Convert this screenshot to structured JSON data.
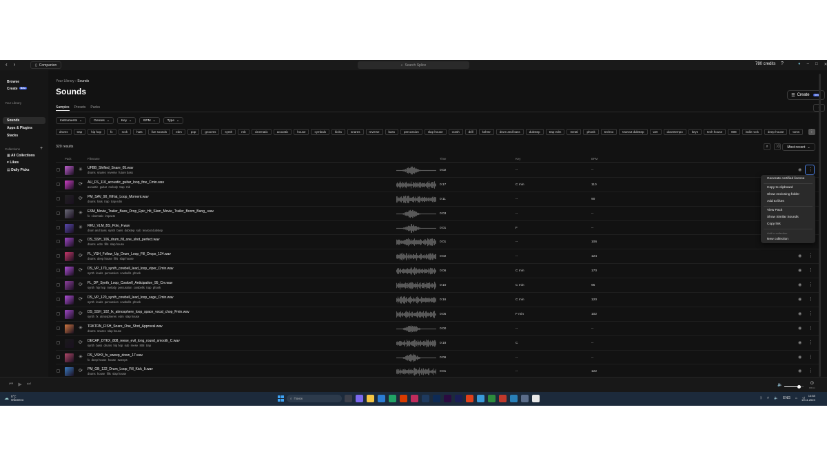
{
  "titlebar": {
    "companion_label": "Companion",
    "search_placeholder": "Search Splice",
    "credits": "780 credits"
  },
  "sidebar": {
    "browse": "Browse",
    "create": "Create",
    "create_badge": "Beta",
    "library_label": "Your Library",
    "sounds": "Sounds",
    "apps_plugins": "Apps & Plugins",
    "stacks": "Stacks",
    "collections_label": "Collections",
    "all_collections": "All Collections",
    "likes": "Likes",
    "daily_picks": "Daily Picks"
  },
  "main": {
    "breadcrumb_parent": "Your Library",
    "breadcrumb_sep": "›",
    "breadcrumb_current": "Sounds",
    "title": "Sounds",
    "create_button": "Create",
    "create_badge": "Beta",
    "tabs": [
      "Samples",
      "Presets",
      "Packs"
    ],
    "filters": [
      "Instruments",
      "Genres",
      "Key",
      "BPM",
      "Type"
    ],
    "chips": [
      "drums",
      "trap",
      "hip hop",
      "fx",
      "rock",
      "hats",
      "live sounds",
      "edm",
      "pop",
      "grooves",
      "synth",
      "rnb",
      "cinematic",
      "acoustic",
      "house",
      "cymbals",
      "kicks",
      "snares",
      "reverse",
      "bass",
      "percussion",
      "slap house",
      "crash",
      "drill",
      "kshmr",
      "drum and bass",
      "dubstep",
      "trap edm",
      "metal",
      "phonk",
      "techno",
      "tearout dubstep",
      "wet",
      "downtempo",
      "keys",
      "tech house",
      "808",
      "indie rock",
      "deep house",
      "toms"
    ],
    "results": "320 results",
    "sort": "Most recent",
    "columns": {
      "pack": "Pack",
      "filename": "Filename",
      "time": "Time",
      "key": "Key",
      "bpm": "BPM"
    }
  },
  "rows": [
    {
      "name": "UFBB_Shifted_Snare_05.wav",
      "tags": [
        "drums",
        "snares",
        "reverse",
        "future bass"
      ],
      "time": "0:02",
      "key": "--",
      "bpm": "--",
      "color": "#c060d0",
      "type": "one-shot"
    },
    {
      "name": "AU_FS_110_acoustic_guitar_loop_fine_Cmin.wav",
      "tags": [
        "acoustic",
        "guitar",
        "melody",
        "trap",
        "rnb"
      ],
      "time": "0:17",
      "key": "C min",
      "bpm": "110",
      "color": "#d040c8",
      "type": "loop"
    },
    {
      "name": "PM_SAV_90_HiHat_Loop_Moment.wav",
      "tags": [
        "drums",
        "hats",
        "trap",
        "trap edm"
      ],
      "time": "0:11",
      "key": "--",
      "bpm": "90",
      "color": "#222222",
      "type": "loop"
    },
    {
      "name": "ESM_Movie_Trailer_Bass_Drop_Epic_Hit_Slam_Movie_Trailer_Boom_Bang_.wav",
      "tags": [
        "fx",
        "cinematic",
        "impacts"
      ],
      "time": "0:03",
      "key": "--",
      "bpm": "--",
      "color": "#6a6a78",
      "type": "one-shot"
    },
    {
      "name": "RKU_VLM_BS_Polo_F.wav",
      "tags": [
        "drum and bass",
        "synth",
        "bass",
        "dubstep",
        "sub",
        "tearout dubstep"
      ],
      "time": "0:01",
      "key": "F",
      "bpm": "--",
      "color": "#5a4ab0",
      "type": "one-shot"
    },
    {
      "name": "DS_SSH_106_drum_fill_one_shot_perfect.wav",
      "tags": [
        "drums",
        "edm",
        "fills",
        "slap house"
      ],
      "time": "0:01",
      "key": "--",
      "bpm": "106",
      "color": "#a048c8",
      "type": "loop"
    },
    {
      "name": "FL_VSH_Follow_Up_Drum_Loop_Fill_Drops_124.wav",
      "tags": [
        "drums",
        "deep house",
        "fills",
        "slap house"
      ],
      "time": "0:02",
      "key": "--",
      "bpm": "124",
      "color": "#c8386a",
      "type": "loop"
    },
    {
      "name": "DS_VP_170_synth_cowbell_lead_loop_viper_Cmin.wav",
      "tags": [
        "synth",
        "leads",
        "percussion",
        "cowbells",
        "phonk"
      ],
      "time": "0:06",
      "key": "C min",
      "bpm": "170",
      "color": "#b050d8",
      "type": "loop"
    },
    {
      "name": "FL_DP_Synth_Loop_Cowbell_Anticipation_95_Cm.wav",
      "tags": [
        "synth",
        "hip hop",
        "melody",
        "percussion",
        "cowbells",
        "trap",
        "phonk"
      ],
      "time": "0:10",
      "key": "C min",
      "bpm": "95",
      "color": "#9040a0",
      "type": "loop"
    },
    {
      "name": "DS_VP_120_synth_cowbell_lead_loop_sage_Cmin.wav",
      "tags": [
        "synth",
        "leads",
        "percussion",
        "cowbells",
        "phonk"
      ],
      "time": "0:16",
      "key": "C min",
      "bpm": "120",
      "color": "#b050d8",
      "type": "loop"
    },
    {
      "name": "DS_SSH_102_fx_atmosphere_loop_space_vocal_chop_Fmin.wav",
      "tags": [
        "synth",
        "fx",
        "atmospheres",
        "edm",
        "slap house"
      ],
      "time": "0:05",
      "key": "F min",
      "bpm": "102",
      "color": "#a048c8",
      "type": "loop"
    },
    {
      "name": "TRKTRN_FISH_Snare_One_Shot_Approval.wav",
      "tags": [
        "drums",
        "snares",
        "slap house"
      ],
      "time": "0:00",
      "key": "--",
      "bpm": "--",
      "color": "#d07840",
      "type": "one-shot"
    },
    {
      "name": "DECAP_DTKX_808_reese_evil_long_round_smooth_C.wav",
      "tags": [
        "synth",
        "bass",
        "drums",
        "hip hop",
        "sub",
        "reese",
        "808",
        "trap"
      ],
      "time": "0:18",
      "key": "C",
      "bpm": "--",
      "color": "#1a1a1a",
      "type": "loop"
    },
    {
      "name": "DS_VSH3_fx_sweep_down_17.wav",
      "tags": [
        "fx",
        "deep house",
        "house",
        "sweeps"
      ],
      "time": "0:06",
      "key": "--",
      "bpm": "--",
      "color": "#b04868",
      "type": "one-shot"
    },
    {
      "name": "PM_GB_122_Drum_Loop_Fill_Kick_It.wav",
      "tags": [
        "drums",
        "house",
        "fills",
        "slap house"
      ],
      "time": "0:01",
      "key": "--",
      "bpm": "122",
      "color": "#3a7ac0",
      "type": "loop"
    }
  ],
  "context_menu": {
    "items": [
      "Generate certified license",
      "Copy to clipboard",
      "Show enclosing folder",
      "Add to likes",
      "View Pack",
      "Show Similar Sounds",
      "Copy link",
      "Add to collection",
      "New collection"
    ]
  },
  "player": {
    "volume": 0.75
  },
  "taskbar": {
    "temperature": "5°C",
    "weather": "Облачно",
    "search": "Поиск",
    "lang": "ENG",
    "time": "14:58",
    "date": "13.11.2023"
  }
}
